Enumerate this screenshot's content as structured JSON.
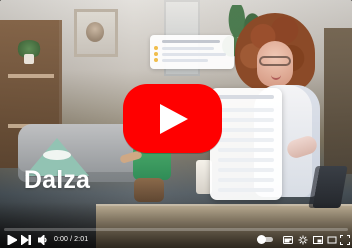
{
  "brand": {
    "logo_text": "Dalza"
  },
  "player": {
    "current_time": "0:00",
    "duration": "2:01",
    "progress": 0.0
  },
  "icons": {
    "big_play": "play-icon",
    "play": "play-icon",
    "next": "next-icon",
    "volume": "volume-icon",
    "autoplay": "toggle-icon",
    "subtitles": "subtitles-icon",
    "settings": "gear-icon",
    "miniplayer": "miniplayer-icon",
    "theater": "theater-icon",
    "fullscreen": "fullscreen-icon"
  },
  "colors": {
    "youtube_red": "#ff0000",
    "logo_green": "#4a8a78",
    "logo_mint": "#92c3b3",
    "controls_text": "#ffffff"
  }
}
